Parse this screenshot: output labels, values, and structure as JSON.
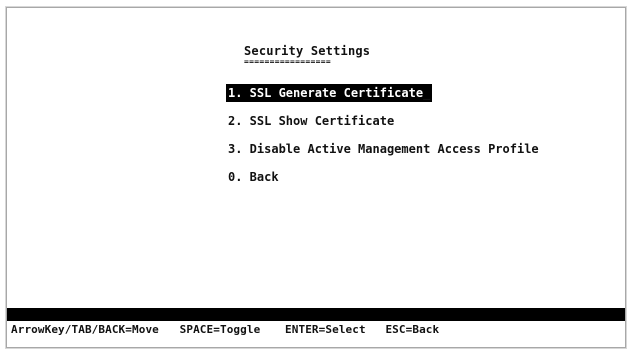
{
  "screen": {
    "title": "Security Settings",
    "title_underline": "================="
  },
  "menu": {
    "items": [
      {
        "number": "1.",
        "label": "SSL Generate Certificate",
        "display": "1. SSL Generate Certificate",
        "selected": true
      },
      {
        "number": "2.",
        "label": "SSL Show Certificate",
        "display": "2. SSL Show Certificate",
        "selected": false
      },
      {
        "number": "3.",
        "label": "Disable Active Management Access Profile",
        "display": "3. Disable Active Management Access Profile",
        "selected": false
      },
      {
        "number": "0.",
        "label": "Back",
        "display": "0. Back",
        "selected": false
      }
    ]
  },
  "status_bar": {
    "move": "ArrowKey/TAB/BACK=Move",
    "toggle": "SPACE=Toggle",
    "select": "ENTER=Select",
    "back": "ESC=Back"
  },
  "colors": {
    "background": "#ffffff",
    "text": "#111111",
    "highlight_background": "#000000",
    "highlight_text": "#ffffff",
    "border": "#a8a8a8"
  }
}
